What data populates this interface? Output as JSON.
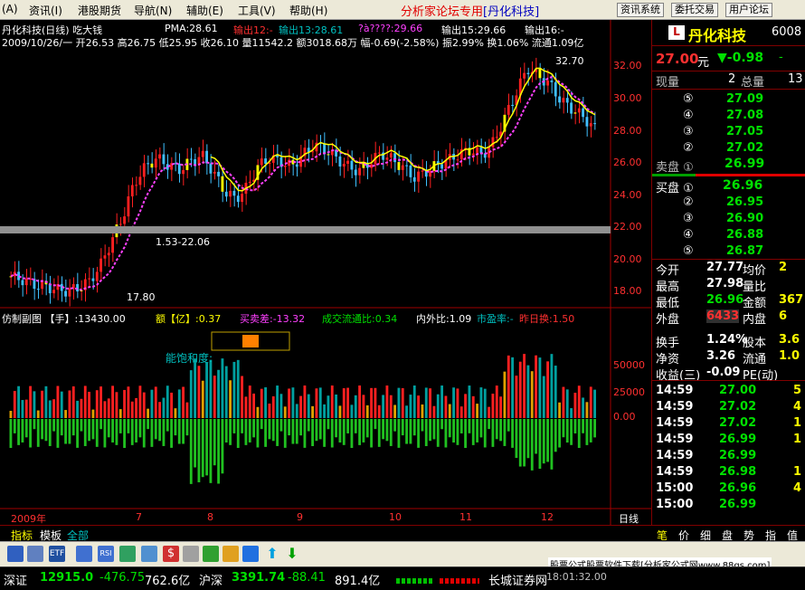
{
  "menu": {
    "icon_text": "(A)",
    "items": [
      "资讯(I)",
      "港股期货",
      "导航(N)",
      "辅助(E)",
      "工具(V)",
      "帮助(H)"
    ],
    "title": "分析家论坛专用",
    "title_stock": "[丹化科技]",
    "buttons": [
      "资讯系统",
      "委托交易",
      "用户论坛"
    ]
  },
  "chart": {
    "header": "丹化科技(日线) 吃大钱",
    "pma": "PMA:28.61",
    "out12": "输出12:-",
    "out13": "输出13:28.61",
    "unknown": "?à????:29.66",
    "out15": "输出15:29.66",
    "out16": "输出16:-",
    "ohlc": "2009/10/26/一  开26.53 高26.75 低25.95 收26.10 量11542.2 额3018.68万 幅-0.69(-2.58%) 振2.99% 换1.06% 流通1.09亿",
    "price_ticks": [
      "32.00",
      "30.00",
      "28.00",
      "26.00",
      "24.00",
      "22.00",
      "20.00",
      "18.00"
    ],
    "annot_high": "32.70",
    "annot_mid": "1.53-22.06",
    "annot_low": "17.80",
    "vol_header_a": "仿制副图 【手】:13430.00",
    "vol_header_b": "额【亿】:0.37",
    "vol_header_c": "买卖差:-13.32",
    "vol_header_d": "成交流通比:0.34",
    "vol_header_e": "内外比:1.09",
    "vol_header_f": "市盈率:-",
    "vol_header_g": "昨日换:1.50",
    "vol_label": "能饱和度:",
    "vol_ticks": [
      "50000",
      "25000",
      "0.00"
    ],
    "date_labels": [
      "2009年",
      "7",
      "8",
      "9",
      "10",
      "11",
      "12"
    ],
    "period": "日线"
  },
  "chart_data": {
    "type": "line",
    "x": [
      "2009-06",
      "2009-07",
      "2009-08",
      "2009-09",
      "2009-10",
      "2009-11",
      "2009-12"
    ],
    "series": [
      {
        "values": [
          18.5,
          18.0,
          23.5,
          25.5,
          24.0,
          26.5,
          30.0
        ]
      }
    ],
    "ylim": [
      17.0,
      33.0
    ]
  },
  "right": {
    "name": "丹化科技",
    "code": "6008",
    "price": "27.00",
    "price_unit": "元",
    "change": "▼-0.98",
    "extra": "-",
    "now_vol_label": "现量",
    "now_vol": "2",
    "total_vol_label": "总量",
    "total_vol": "13",
    "sell": [
      {
        "lvl": "⑤",
        "p": "27.09"
      },
      {
        "lvl": "④",
        "p": "27.08"
      },
      {
        "lvl": "③",
        "p": "27.05"
      },
      {
        "lvl": "②",
        "p": "27.02"
      }
    ],
    "sell1_label": "卖盘 ①",
    "sell1": "26.99",
    "buy1_label": "买盘 ①",
    "buy1": "26.96",
    "buy": [
      {
        "lvl": "②",
        "p": "26.95"
      },
      {
        "lvl": "③",
        "p": "26.90"
      },
      {
        "lvl": "④",
        "p": "26.88"
      },
      {
        "lvl": "⑤",
        "p": "26.87"
      }
    ],
    "stats": [
      {
        "l1": "今开",
        "v1": "27.77",
        "l2": "均价",
        "v2": "2"
      },
      {
        "l1": "最高",
        "v1": "27.98",
        "l2": "量比",
        "v2": ""
      },
      {
        "l1": "最低",
        "v1": "26.96",
        "l2": "金额",
        "v2": "367"
      },
      {
        "l1": "外盘",
        "v1": "6433",
        "l2": "内盘",
        "v2": "6"
      },
      {
        "l1": "换手",
        "v1": "1.24%",
        "l2": "股本",
        "v2": "3.6"
      },
      {
        "l1": "净资",
        "v1": "3.26",
        "l2": "流通",
        "v2": "1.0"
      },
      {
        "l1": "收益(三)",
        "v1": "-0.09",
        "l2": "PE(动)",
        "v2": ""
      }
    ],
    "ticks": [
      {
        "t": "14:59",
        "p": "27.00",
        "v": "5"
      },
      {
        "t": "14:59",
        "p": "27.02",
        "v": "4"
      },
      {
        "t": "14:59",
        "p": "27.02",
        "v": "1"
      },
      {
        "t": "14:59",
        "p": "26.99",
        "v": "1"
      },
      {
        "t": "14:59",
        "p": "26.99",
        "v": ""
      },
      {
        "t": "14:59",
        "p": "26.98",
        "v": "1"
      },
      {
        "t": "15:00",
        "p": "26.96",
        "v": "4"
      },
      {
        "t": "15:00",
        "p": "26.99",
        "v": ""
      }
    ],
    "tabs": [
      "笔",
      "价",
      "细",
      "盘",
      "势",
      "指",
      "值"
    ]
  },
  "bottom_tabs": [
    "指标",
    "模板",
    "全部"
  ],
  "status": {
    "sz_label": "深证",
    "sz_val": "12915.0",
    "sz_chg": "-476.75",
    "sz_amt": "762.6亿",
    "sh_label": "沪深",
    "sh_val": "3391.74",
    "sh_chg": "-88.41",
    "sh_amt": "891.4亿",
    "broker": "长城证券网",
    "time": "18:01:32.00",
    "watermark": "股票公式股票软件下载[分析家公式网www.88gs.com]"
  }
}
